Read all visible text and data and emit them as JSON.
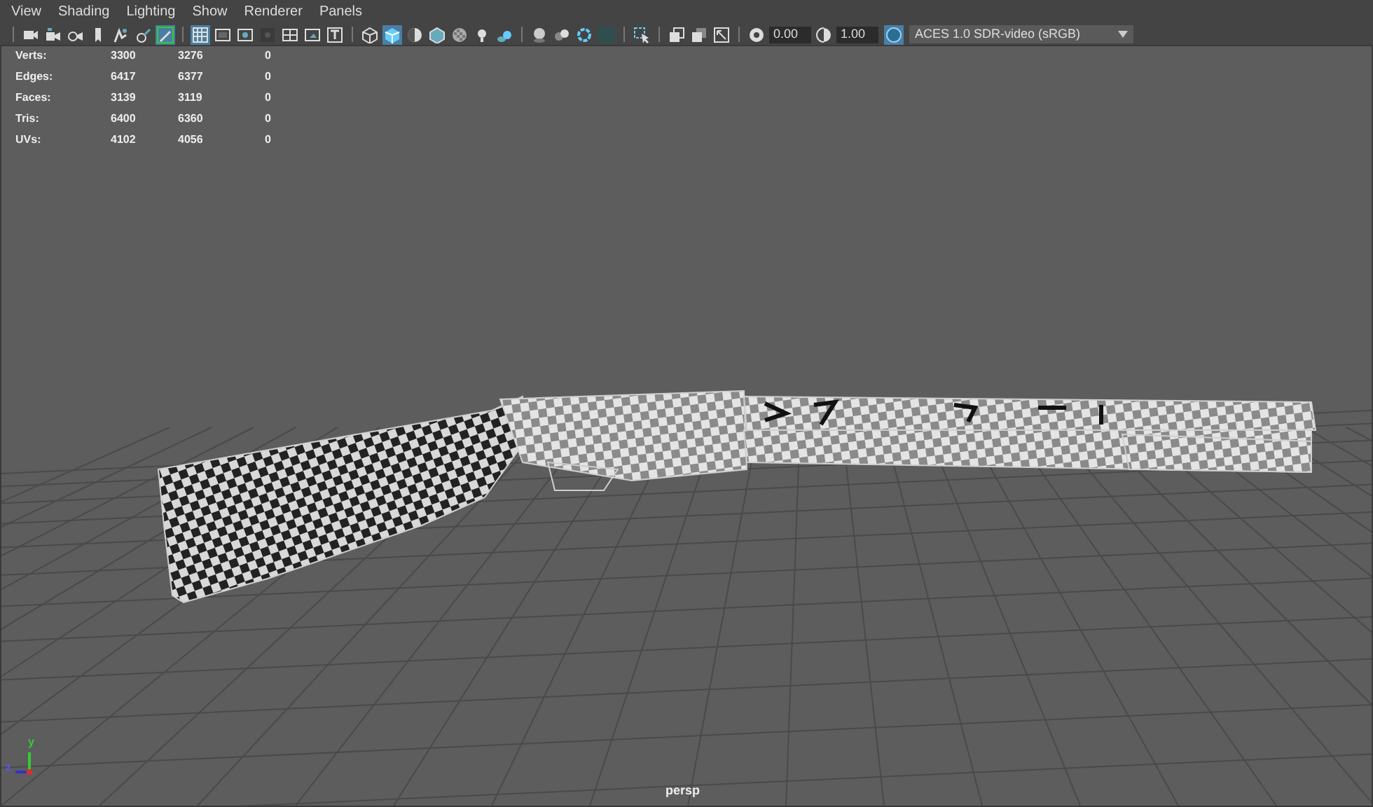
{
  "menu": [
    "View",
    "Shading",
    "Lighting",
    "Show",
    "Renderer",
    "Panels"
  ],
  "toolbar": {
    "groups": [
      [
        {
          "selected": false
        },
        {
          "selected": false
        },
        {
          "selected": false
        },
        {
          "selected": false
        },
        {
          "selected": false
        },
        {
          "selected": false
        },
        {
          "selected": true
        }
      ],
      [
        {
          "selected": true
        },
        {
          "selected": false
        },
        {
          "selected": false
        },
        {
          "selected": false
        },
        {
          "selected": false
        },
        {
          "selected": false
        },
        {
          "selected": false
        }
      ],
      [
        {
          "selected": false
        },
        {
          "selected": true
        },
        {
          "selected": false
        },
        {
          "selected": false
        },
        {
          "selected": false
        },
        {
          "selected": false
        },
        {
          "selected": false
        }
      ],
      [
        {
          "selected": false
        },
        {
          "selected": false
        },
        {
          "selected": false
        },
        {
          "selected": false
        }
      ],
      [
        {
          "selected": false
        }
      ],
      [
        {
          "selected": false
        },
        {
          "selected": false
        },
        {
          "selected": false
        }
      ]
    ],
    "exposure": "0.00",
    "gamma": "1.00",
    "color_management": {
      "selected": true
    },
    "view_transform": "ACES 1.0 SDR-video (sRGB)"
  },
  "stats": [
    {
      "label": "Verts:",
      "values": [
        "3300",
        "3276",
        "0"
      ]
    },
    {
      "label": "Edges:",
      "values": [
        "6417",
        "6377",
        "0"
      ]
    },
    {
      "label": "Faces:",
      "values": [
        "3139",
        "3119",
        "0"
      ]
    },
    {
      "label": "Tris:",
      "values": [
        "6400",
        "6360",
        "0"
      ]
    },
    {
      "label": "UVs:",
      "values": [
        "4102",
        "4056",
        "0"
      ]
    }
  ],
  "axis": {
    "y": "y",
    "z": "z"
  },
  "camera": "persp"
}
